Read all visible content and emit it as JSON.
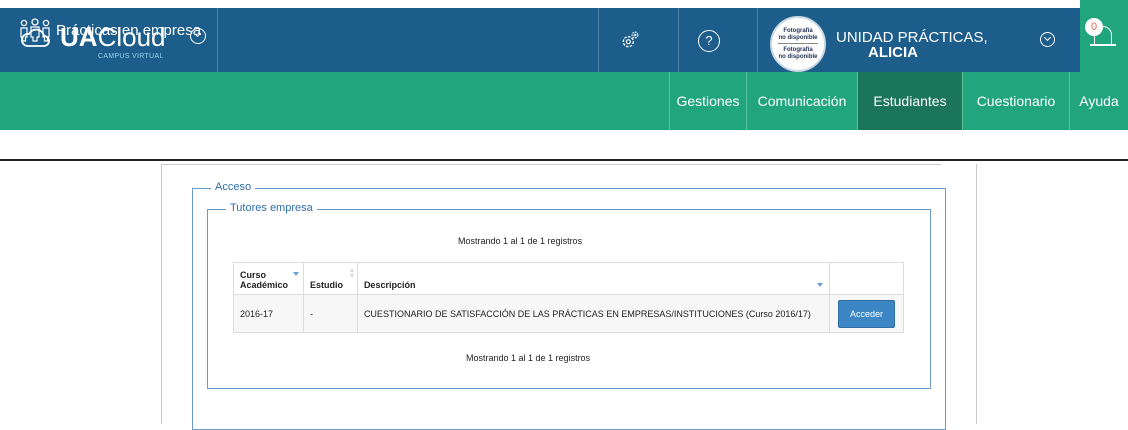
{
  "header": {
    "brand_bold": "UA",
    "brand_light": "Cloud",
    "brand_sub": "CAMPUS VIRTUAL",
    "avatar_text_1": "Fotografía",
    "avatar_text_2": "no disponible",
    "avatar_text_3": "Fotografía",
    "avatar_text_4": "no disponible",
    "user_line1": "UNIDAD PRÁCTICAS,",
    "user_line2": "ALICIA",
    "notifications_count": "0"
  },
  "nav": {
    "app_title": "Prácticas en empresa",
    "items": [
      {
        "label": "Gestiones"
      },
      {
        "label": "Comunicación"
      },
      {
        "label": "Estudiantes"
      },
      {
        "label": "Cuestionario"
      },
      {
        "label": "Ayuda"
      }
    ],
    "active": "Estudiantes"
  },
  "content": {
    "fieldset_outer": "Acceso",
    "fieldset_inner": "Tutores empresa",
    "info_top": "Mostrando 1 al 1 de 1 registros",
    "info_bottom": "Mostrando 1 al 1 de 1 registros",
    "table": {
      "headers": [
        "Curso Académico",
        "Estudio",
        "Descripción",
        ""
      ],
      "header_curso_1": "Curso",
      "header_curso_2": "Académico",
      "rows": [
        {
          "curso": "2016-17",
          "estudio": "-",
          "descripcion": "CUESTIONARIO DE SATISFACCIÓN DE LAS PRÁCTICAS EN EMPRESAS/INSTITUCIONES (Curso 2016/17)",
          "action": "Acceder"
        }
      ]
    }
  },
  "colors": {
    "topbar": "#1c5d8b",
    "navbar": "#21a57c",
    "nav_active": "#1b7558",
    "button": "#3d86c6",
    "legend": "#2f6fa8"
  },
  "icons": [
    "cloud-icon",
    "chevron-down-icon",
    "gear-icon",
    "help-icon",
    "bell-icon",
    "people-icon",
    "sort-desc-icon",
    "sort-both-icon"
  ]
}
